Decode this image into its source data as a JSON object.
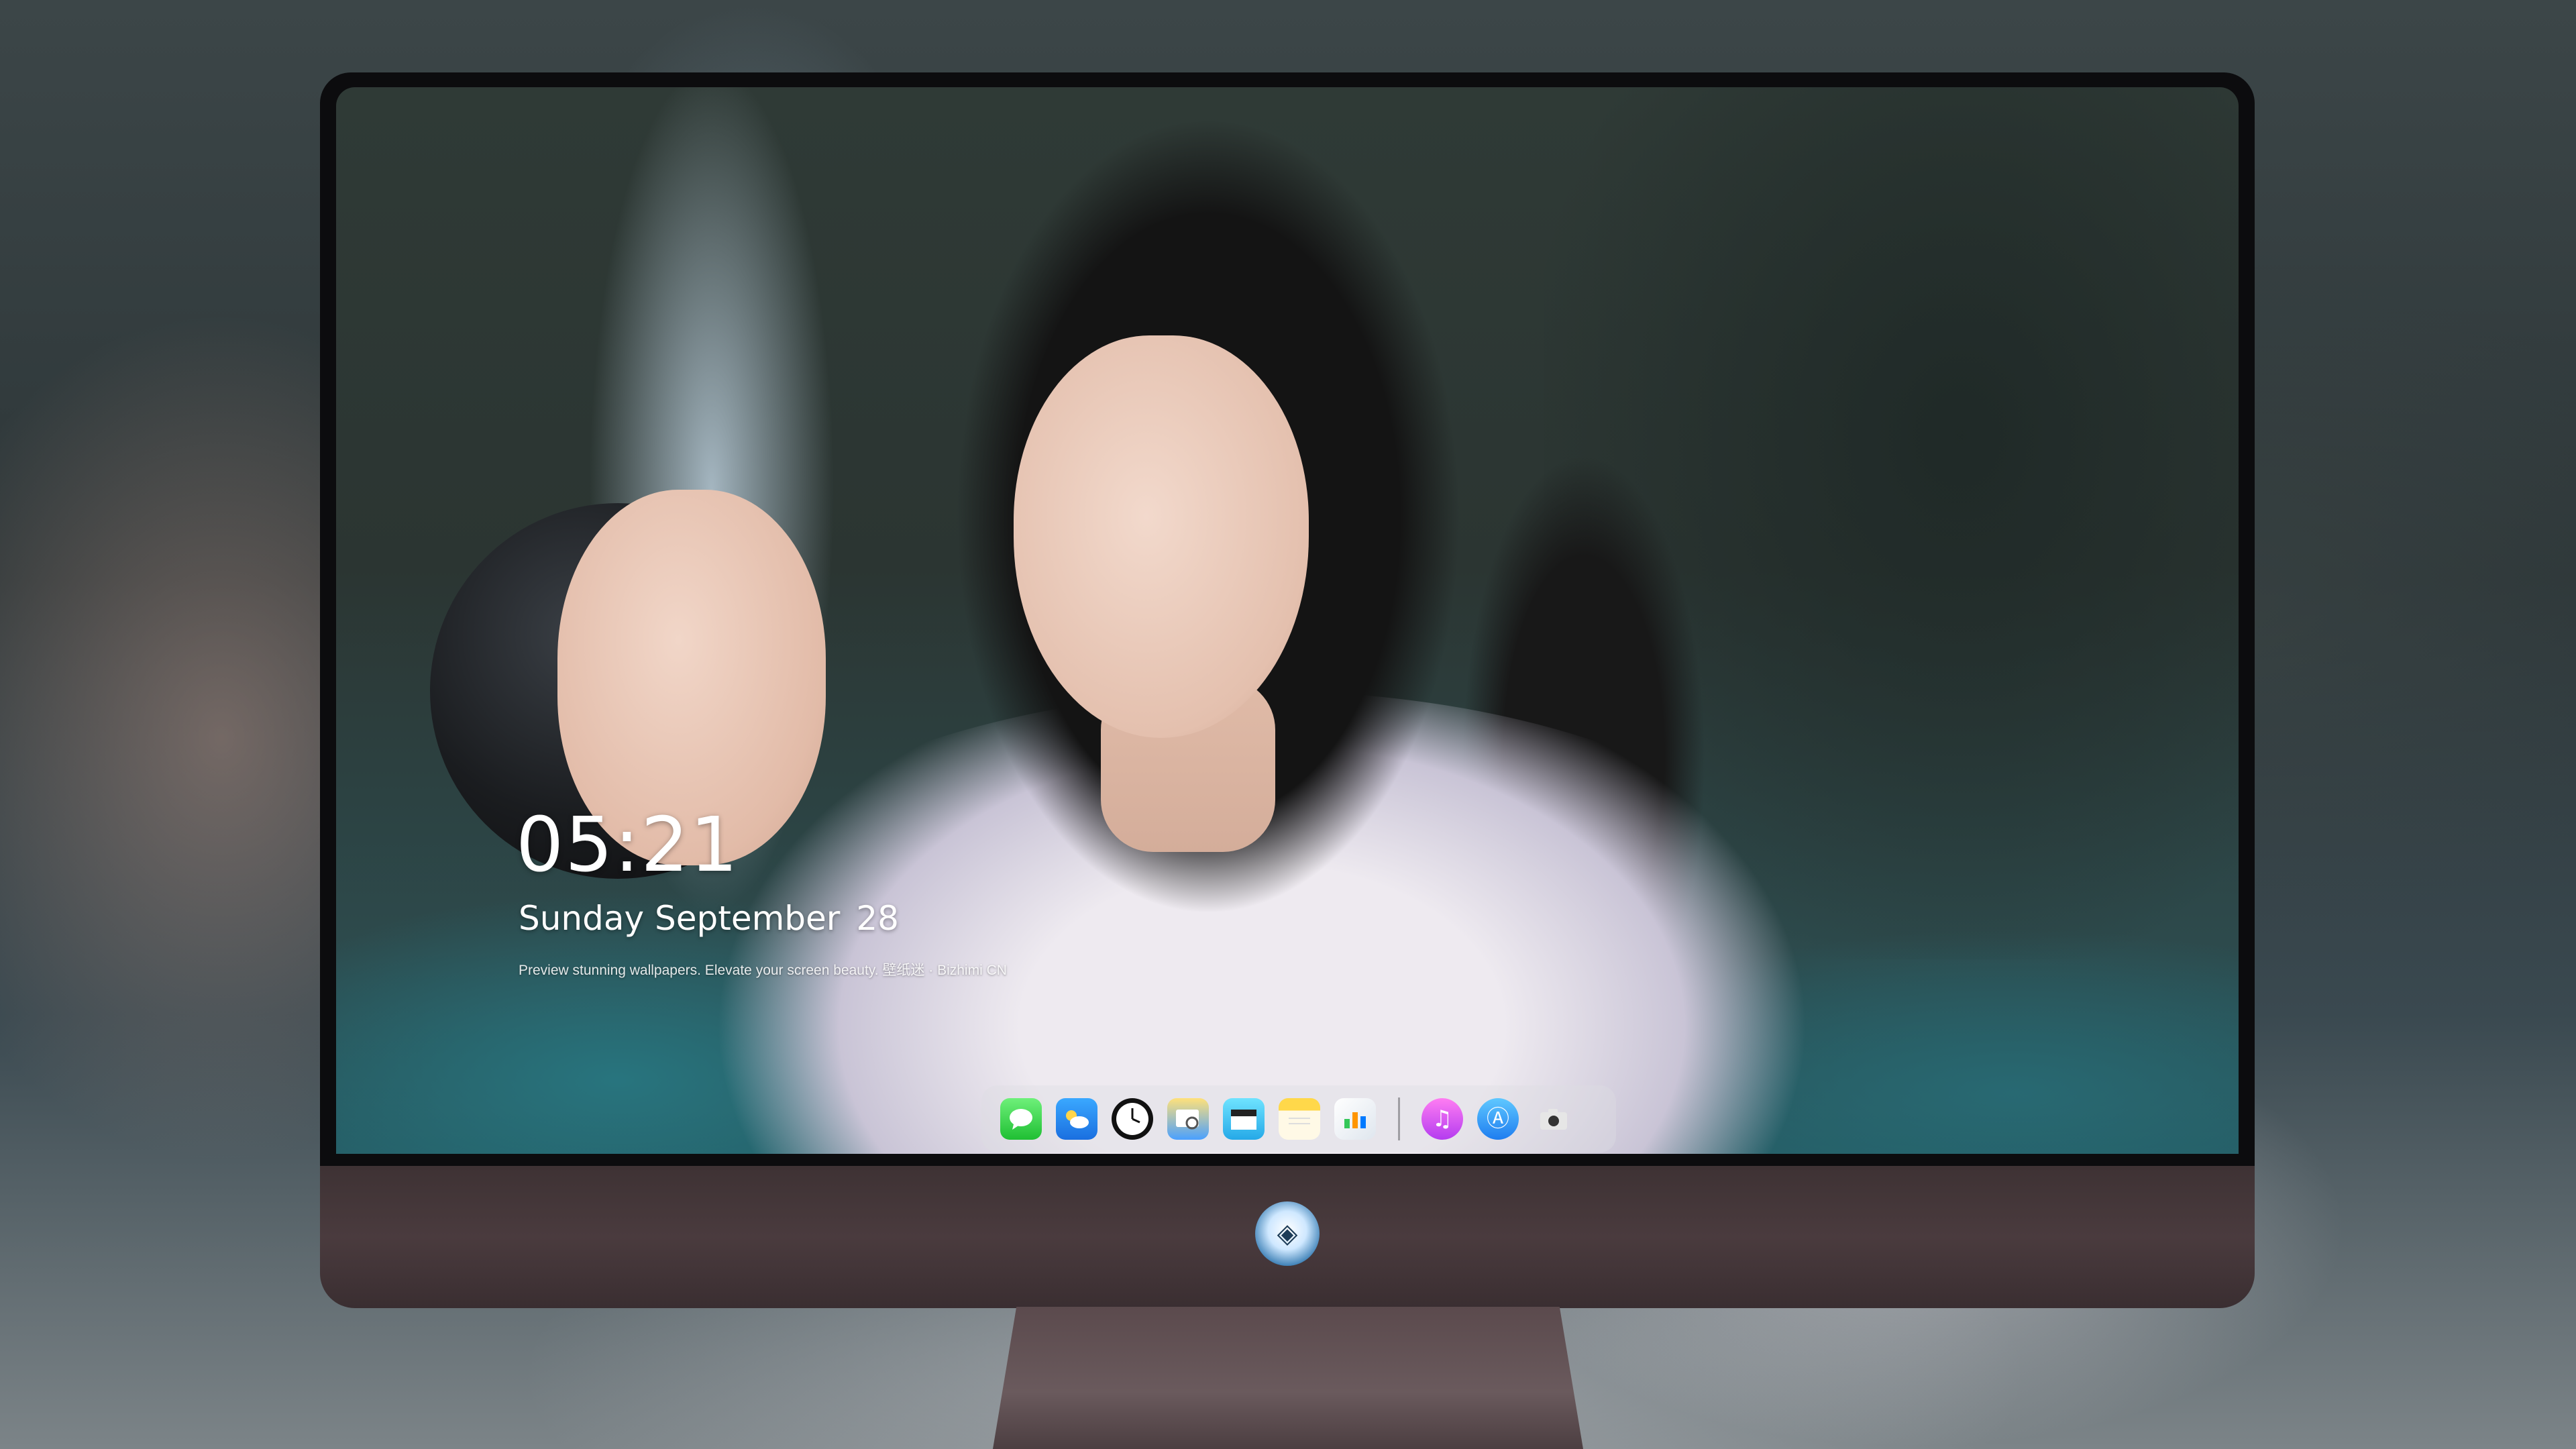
{
  "lock_screen": {
    "time": "05:21",
    "date_main": "Sunday September",
    "date_day": "28",
    "tagline": "Preview stunning wallpapers. Elevate your screen beauty. 壁纸迷 · Bizhimi CN"
  },
  "dock": {
    "items": [
      {
        "name": "messages",
        "icon": "messages-icon",
        "color": "#1fbf33"
      },
      {
        "name": "weather",
        "icon": "weather-icon",
        "color": "#1a6fe0"
      },
      {
        "name": "clock",
        "icon": "clock-icon",
        "color": "#111111"
      },
      {
        "name": "preview",
        "icon": "preview-icon",
        "color": "#4aa0ff"
      },
      {
        "name": "clips",
        "icon": "clips-icon",
        "color": "#25a9e8"
      },
      {
        "name": "notes",
        "icon": "notes-icon",
        "color": "#ffd84a"
      },
      {
        "name": "numbers",
        "icon": "numbers-icon",
        "color": "#dfe6ee"
      },
      {
        "name": "music",
        "icon": "music-icon",
        "color": "#b43cf0"
      },
      {
        "name": "app-store",
        "icon": "app-store-icon",
        "color": "#1e7df0"
      },
      {
        "name": "camera",
        "icon": "camera-icon",
        "color": "#d8d8d8"
      }
    ]
  },
  "monitor": {
    "logo_icon": "dragon-mascot-logo",
    "chin_color": "#4a3b3e"
  }
}
